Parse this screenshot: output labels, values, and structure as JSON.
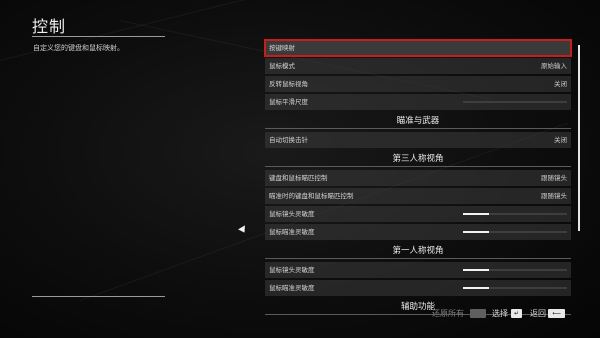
{
  "page": {
    "title": "控制",
    "description": "自定义您的键盘和鼠标映射。"
  },
  "list": {
    "row1": {
      "label": "按键映射"
    },
    "row2": {
      "label": "鼠标模式",
      "value": "原始输入"
    },
    "row3": {
      "label": "反转鼠标视角",
      "value": "关闭"
    },
    "row4": {
      "label": "鼠标平滑尺度",
      "fill": 0.0
    },
    "section1": "瞄准与武器",
    "row5": {
      "label": "自动切换击针",
      "value": "关闭"
    },
    "section2": "第三人称视角",
    "row6": {
      "label": "键盘和鼠标瞄匹控制",
      "value": "跟随镜头"
    },
    "row7": {
      "label": "瞄准时的键盘和鼠标瞄匹控制",
      "value": "跟随镜头"
    },
    "row8": {
      "label": "鼠标镜头灵敏度",
      "fill": 0.25
    },
    "row9": {
      "label": "鼠标瞄准灵敏度",
      "fill": 0.25
    },
    "section3": "第一人称视角",
    "row10": {
      "label": "鼠标镜头灵敏度",
      "fill": 0.25
    },
    "row11": {
      "label": "鼠标瞄准灵敏度",
      "fill": 0.25
    },
    "section4": "辅助功能"
  },
  "footer": {
    "reset_label": "还原所有",
    "select_label": "选择",
    "back_label": "返回"
  },
  "colors": {
    "selection_border": "#c61d1d",
    "slider_fill": "#f2f2f2"
  }
}
